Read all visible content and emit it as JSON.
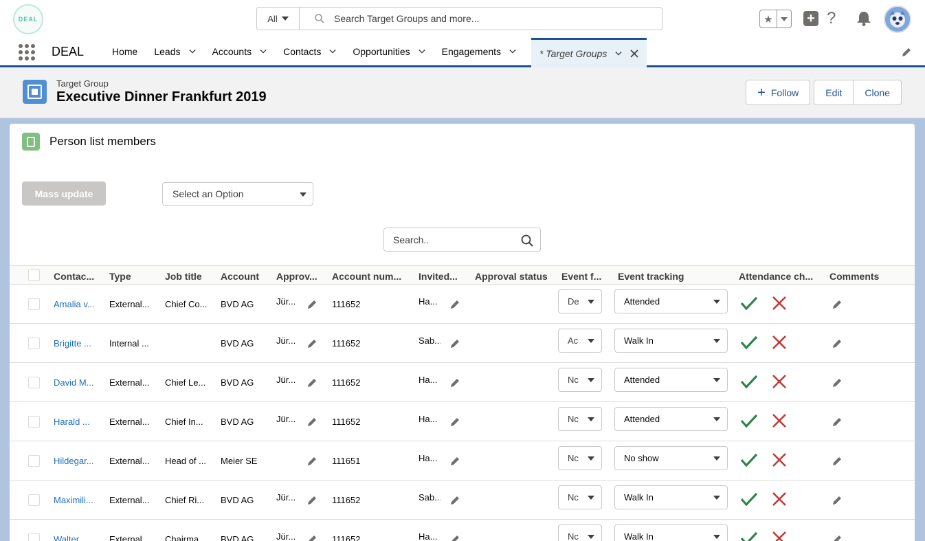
{
  "global_header": {
    "logo_text": "DEAL",
    "search": {
      "scope": "All",
      "placeholder": "Search Target Groups and more..."
    },
    "icons": [
      "favorites-star-icon",
      "favorites-dropdown-icon",
      "global-actions-plus-icon",
      "help-icon",
      "notifications-bell-icon",
      "user-avatar"
    ]
  },
  "nav": {
    "app_name": "DEAL",
    "items": [
      {
        "label": "Home"
      },
      {
        "label": "Leads"
      },
      {
        "label": "Accounts"
      },
      {
        "label": "Contacts"
      },
      {
        "label": "Opportunities"
      },
      {
        "label": "Engagements"
      }
    ],
    "active_tab": "* Target Groups"
  },
  "record": {
    "object_type": "Target Group",
    "title": "Executive Dinner Frankfurt 2019",
    "buttons": {
      "follow": "Follow",
      "edit": "Edit",
      "clone": "Clone"
    }
  },
  "card": {
    "title": "Person list members",
    "mass_update_label": "Mass update",
    "select_placeholder": "Select an Option",
    "search_placeholder": "Search.."
  },
  "table": {
    "headers": [
      "Contac...",
      "Type",
      "Job title",
      "Account",
      "Approv...",
      "Account num...",
      "Invited...",
      "Approval status",
      "Event f...",
      "Event tracking",
      "Attendance ch...",
      "Comments"
    ],
    "rows": [
      {
        "contact": "Amalia v...",
        "type": "External...",
        "job": "Chief Co...",
        "account": "BVD AG",
        "approver": "Jür...",
        "account_num": "111652",
        "invited": "Ha...",
        "approval_status": "",
        "event_f": "De",
        "tracking": "Attended"
      },
      {
        "contact": "Brigitte ...",
        "type": "Internal ...",
        "job": "",
        "account": "BVD AG",
        "approver": "Jür...",
        "account_num": "111652",
        "invited": "Sab...",
        "approval_status": "",
        "event_f": "Ac",
        "tracking": "Walk In"
      },
      {
        "contact": "David M...",
        "type": "External...",
        "job": "Chief Le...",
        "account": "BVD AG",
        "approver": "Jür...",
        "account_num": "111652",
        "invited": "Ha...",
        "approval_status": "",
        "event_f": "Nc",
        "tracking": "Attended"
      },
      {
        "contact": "Harald ...",
        "type": "External...",
        "job": "Chief In...",
        "account": "BVD AG",
        "approver": "Jür...",
        "account_num": "111652",
        "invited": "Ha...",
        "approval_status": "",
        "event_f": "Nc",
        "tracking": "Attended"
      },
      {
        "contact": "Hildegar...",
        "type": "External...",
        "job": "Head of ...",
        "account": "Meier SE",
        "approver": "",
        "account_num": "111651",
        "invited": "Ha...",
        "approval_status": "",
        "event_f": "Nc",
        "tracking": "No show"
      },
      {
        "contact": "Maximili...",
        "type": "External...",
        "job": "Chief Ri...",
        "account": "BVD AG",
        "approver": "Jür...",
        "account_num": "111652",
        "invited": "Sab...",
        "approval_status": "",
        "event_f": "Nc",
        "tracking": "Walk In"
      },
      {
        "contact": "Walter ...",
        "type": "External...",
        "job": "Chairma...",
        "account": "BVD AG",
        "approver": "Jür...",
        "account_num": "111652",
        "invited": "Ha...",
        "approval_status": "",
        "event_f": "Nc",
        "tracking": "Walk In"
      }
    ]
  },
  "colors": {
    "brand": "#1b5297",
    "link": "#1b6fbe",
    "check": "#2e844a",
    "cross": "#c23934"
  }
}
